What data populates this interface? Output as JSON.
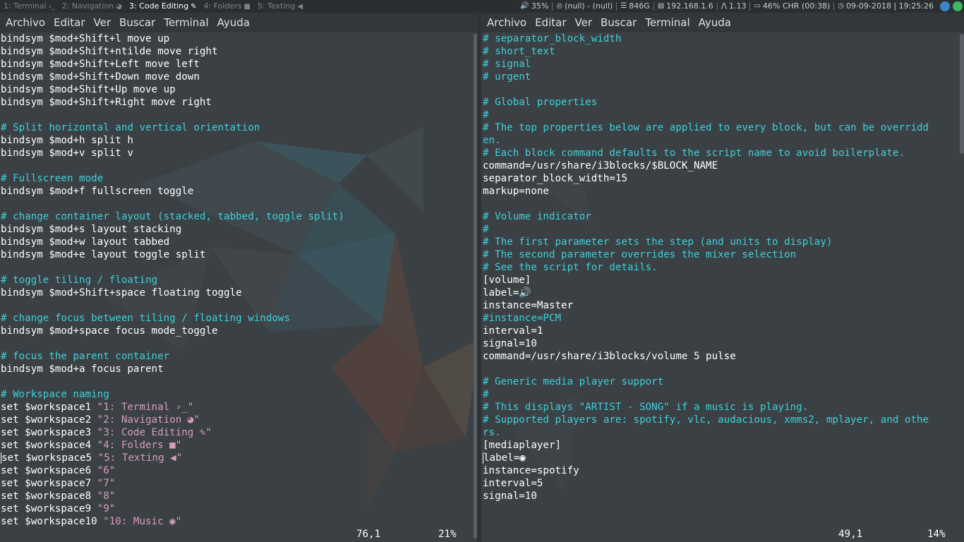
{
  "topbar": {
    "workspaces": [
      {
        "label": "1: Terminal",
        "glyph": "›_",
        "active": false
      },
      {
        "label": "2: Navigation",
        "glyph": "◕",
        "active": false
      },
      {
        "label": "3: Code Editing",
        "glyph": "✎",
        "active": true
      },
      {
        "label": "4: Folders",
        "glyph": "■",
        "active": false
      },
      {
        "label": "5: Texting",
        "glyph": "◀",
        "active": false
      }
    ],
    "status": {
      "volume": "35%",
      "network": "(null) - (null)",
      "disk": "846G",
      "ip": "192.168.1.6",
      "load": "1.13",
      "battery": "46% CHR (00:38)",
      "datetime": "09-09-2018 | 19:25:26"
    },
    "colors": {
      "bar_bg": "#2b2e31",
      "active_ws": "#ffffff",
      "inactive_ws": "#7c8389"
    }
  },
  "left_terminal": {
    "menu": [
      "Archivo",
      "Editar",
      "Ver",
      "Buscar",
      "Terminal",
      "Ayuda"
    ],
    "lines": [
      [
        {
          "t": "bindsym $mod+Shift+l move up"
        }
      ],
      [
        {
          "t": "bindsym $mod+Shift+ntilde move right"
        }
      ],
      [
        {
          "t": "bindsym $mod+Shift+Left move left"
        }
      ],
      [
        {
          "t": "bindsym $mod+Shift+Down move down"
        }
      ],
      [
        {
          "t": "bindsym $mod+Shift+Up move up"
        }
      ],
      [
        {
          "t": "bindsym $mod+Shift+Right move right"
        }
      ],
      [
        {
          "t": ""
        }
      ],
      [
        {
          "t": "# Split horizontal and vertical orientation",
          "c": "cm"
        }
      ],
      [
        {
          "t": "bindsym $mod+h split h"
        }
      ],
      [
        {
          "t": "bindsym $mod+v split v"
        }
      ],
      [
        {
          "t": ""
        }
      ],
      [
        {
          "t": "# Fullscreen mode",
          "c": "cm"
        }
      ],
      [
        {
          "t": "bindsym $mod+f fullscreen toggle"
        }
      ],
      [
        {
          "t": ""
        }
      ],
      [
        {
          "t": "# change container layout (stacked, tabbed, toggle split)",
          "c": "cm"
        }
      ],
      [
        {
          "t": "bindsym $mod+s layout stacking"
        }
      ],
      [
        {
          "t": "bindsym $mod+w layout tabbed"
        }
      ],
      [
        {
          "t": "bindsym $mod+e layout toggle split"
        }
      ],
      [
        {
          "t": ""
        }
      ],
      [
        {
          "t": "# toggle tiling / floating",
          "c": "cm"
        }
      ],
      [
        {
          "t": "bindsym $mod+Shift+space floating toggle"
        }
      ],
      [
        {
          "t": ""
        }
      ],
      [
        {
          "t": "# change focus between tiling / floating windows",
          "c": "cm"
        }
      ],
      [
        {
          "t": "bindsym $mod+space focus mode_toggle"
        }
      ],
      [
        {
          "t": ""
        }
      ],
      [
        {
          "t": "# focus the parent container",
          "c": "cm"
        }
      ],
      [
        {
          "t": "bindsym $mod+a focus parent"
        }
      ],
      [
        {
          "t": ""
        }
      ],
      [
        {
          "t": "# Workspace naming",
          "c": "cm"
        }
      ],
      [
        {
          "t": "set $workspace1 "
        },
        {
          "t": "\"1: Terminal ›_\"",
          "c": "str"
        }
      ],
      [
        {
          "t": "set $workspace2 "
        },
        {
          "t": "\"2: Navigation ◕\"",
          "c": "str"
        }
      ],
      [
        {
          "t": "set $workspace3 "
        },
        {
          "t": "\"3: Code Editing ✎\"",
          "c": "str"
        }
      ],
      [
        {
          "t": "set $workspace4 "
        },
        {
          "t": "\"4: Folders ■\"",
          "c": "str"
        }
      ],
      [
        {
          "t": "set $workspace5 "
        },
        {
          "t": "\"5: Texting ◀\"",
          "c": "str"
        }
      ],
      [
        {
          "t": "set $workspace6 "
        },
        {
          "t": "\"6\"",
          "c": "str"
        }
      ],
      [
        {
          "t": "set $workspace7 "
        },
        {
          "t": "\"7\"",
          "c": "str"
        }
      ],
      [
        {
          "t": "set $workspace8 "
        },
        {
          "t": "\"8\"",
          "c": "str"
        }
      ],
      [
        {
          "t": "set $workspace9 "
        },
        {
          "t": "\"9\"",
          "c": "str"
        }
      ],
      [
        {
          "t": "set $workspace10 "
        },
        {
          "t": "\"10: Music ◉\"",
          "c": "str"
        }
      ]
    ],
    "cursor_line": 33,
    "position": "76,1",
    "percent": "21%"
  },
  "right_terminal": {
    "menu": [
      "Archivo",
      "Editar",
      "Ver",
      "Buscar",
      "Terminal",
      "Ayuda"
    ],
    "lines": [
      [
        {
          "t": "# separator_block_width",
          "c": "cm"
        }
      ],
      [
        {
          "t": "# short_text",
          "c": "cm"
        }
      ],
      [
        {
          "t": "# signal",
          "c": "cm"
        }
      ],
      [
        {
          "t": "# urgent",
          "c": "cm"
        }
      ],
      [
        {
          "t": ""
        }
      ],
      [
        {
          "t": "# Global properties",
          "c": "cm"
        }
      ],
      [
        {
          "t": "#",
          "c": "cm"
        }
      ],
      [
        {
          "t": "# The top properties below are applied to every block, but can be overridd",
          "c": "cm"
        }
      ],
      [
        {
          "t": "en.",
          "c": "cm"
        }
      ],
      [
        {
          "t": "# Each block command defaults to the script name to avoid boilerplate.",
          "c": "cm"
        }
      ],
      [
        {
          "t": "command=/usr/share/i3blocks/$BLOCK_NAME"
        }
      ],
      [
        {
          "t": "separator_block_width=15"
        }
      ],
      [
        {
          "t": "markup=none"
        }
      ],
      [
        {
          "t": ""
        }
      ],
      [
        {
          "t": "# Volume indicator",
          "c": "cm"
        }
      ],
      [
        {
          "t": "#",
          "c": "cm"
        }
      ],
      [
        {
          "t": "# The first parameter sets the step (and units to display)",
          "c": "cm"
        }
      ],
      [
        {
          "t": "# The second parameter overrides the mixer selection",
          "c": "cm"
        }
      ],
      [
        {
          "t": "# See the script for details.",
          "c": "cm"
        }
      ],
      [
        {
          "t": "[volume]"
        }
      ],
      [
        {
          "t": "label=🔊"
        }
      ],
      [
        {
          "t": "instance=Master"
        }
      ],
      [
        {
          "t": "#instance=PCM",
          "c": "cm"
        }
      ],
      [
        {
          "t": "interval=1"
        }
      ],
      [
        {
          "t": "signal=10"
        }
      ],
      [
        {
          "t": "command=/usr/share/i3blocks/volume 5 pulse"
        }
      ],
      [
        {
          "t": ""
        }
      ],
      [
        {
          "t": "# Generic media player support",
          "c": "cm"
        }
      ],
      [
        {
          "t": "#",
          "c": "cm"
        }
      ],
      [
        {
          "t": "# This displays \"ARTIST - SONG\" if a music is playing.",
          "c": "cm"
        }
      ],
      [
        {
          "t": "# Supported players are: spotify, vlc, audacious, xmms2, mplayer, and othe",
          "c": "cm"
        }
      ],
      [
        {
          "t": "rs.",
          "c": "cm"
        }
      ],
      [
        {
          "t": "[mediaplayer]"
        }
      ],
      [
        {
          "t": "label=◉"
        }
      ],
      [
        {
          "t": "instance=spotify"
        }
      ],
      [
        {
          "t": "interval=5"
        }
      ],
      [
        {
          "t": "signal=10"
        }
      ]
    ],
    "cursor_line": 33,
    "position": "49,1",
    "percent": "14%"
  }
}
